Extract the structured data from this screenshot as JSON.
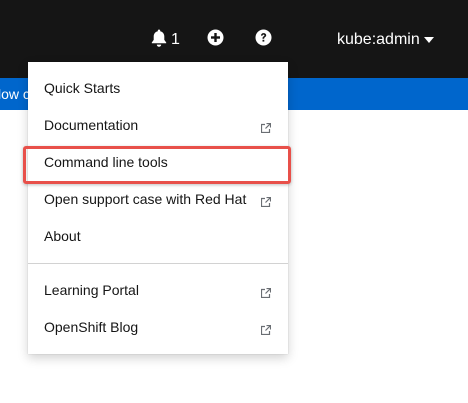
{
  "masthead": {
    "notification_count": "1",
    "user_label": "kube:admin"
  },
  "banner": {
    "text": "low c"
  },
  "help_menu": {
    "items": [
      {
        "label": "Quick Starts",
        "external": false
      },
      {
        "label": "Documentation",
        "external": true
      },
      {
        "label": "Command line tools",
        "external": false
      },
      {
        "label": "Open support case with Red Hat",
        "external": true
      },
      {
        "label": "About",
        "external": false
      }
    ],
    "secondary_items": [
      {
        "label": "Learning Portal",
        "external": true
      },
      {
        "label": "OpenShift Blog",
        "external": true
      }
    ]
  },
  "colors": {
    "masthead_bg": "#151515",
    "banner_bg": "#0066cc",
    "highlight_border": "#e8504a"
  }
}
